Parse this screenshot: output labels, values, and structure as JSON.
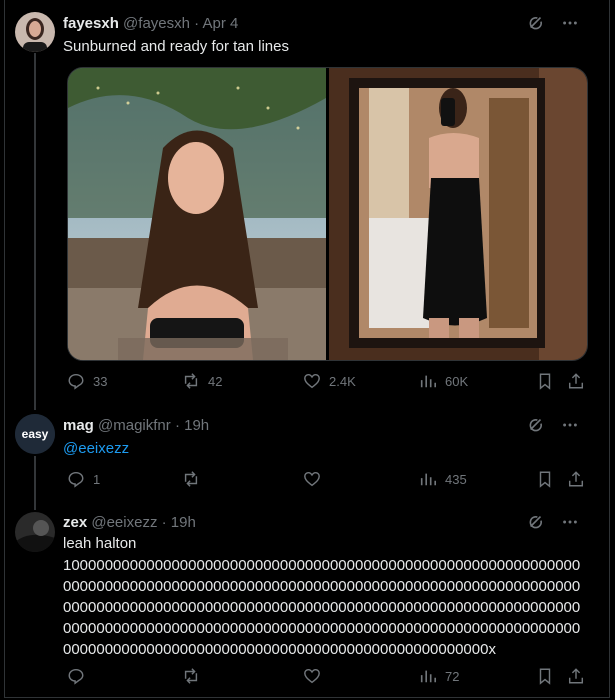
{
  "tweets": [
    {
      "name": "fayesxh",
      "handle": "@fayesxh",
      "dot": "·",
      "time": "Apr 4",
      "text": "Sunburned and ready for tan lines",
      "stats": {
        "replies": "33",
        "reposts": "42",
        "likes": "2.4K",
        "views": "60K"
      }
    },
    {
      "name": "mag",
      "handle": "@magikfnr",
      "dot": "·",
      "time": "19h",
      "mention": "@eeixezz",
      "avatar_label": "easy",
      "stats": {
        "replies": "1",
        "reposts": "",
        "likes": "",
        "views": "435"
      }
    },
    {
      "name": "zex",
      "handle": "@eeixezz",
      "dot": "·",
      "time": "19h",
      "line1": "leah halton",
      "line2": "10000000000000000000000000000000000000000000000000000000000000000000000000000000000000000000000000000000000000000000000000000000000000000000000000000000000000000000000000000000000000000000000000000000000000000000000000000000000000000000000000000000000000000000000000000000000000000000000000000000000x",
      "stats": {
        "replies": "",
        "reposts": "",
        "likes": "",
        "views": "72"
      }
    }
  ],
  "icons": {
    "grok": "grok-icon",
    "more": "more-icon",
    "reply": "reply-icon",
    "repost": "repost-icon",
    "like": "like-icon",
    "views": "views-icon",
    "bookmark": "bookmark-icon",
    "share": "share-icon"
  },
  "colors": {
    "background": "#000000",
    "text": "#e7e9ea",
    "muted": "#71767b",
    "link": "#1d9bf0",
    "border": "#2f3336"
  }
}
